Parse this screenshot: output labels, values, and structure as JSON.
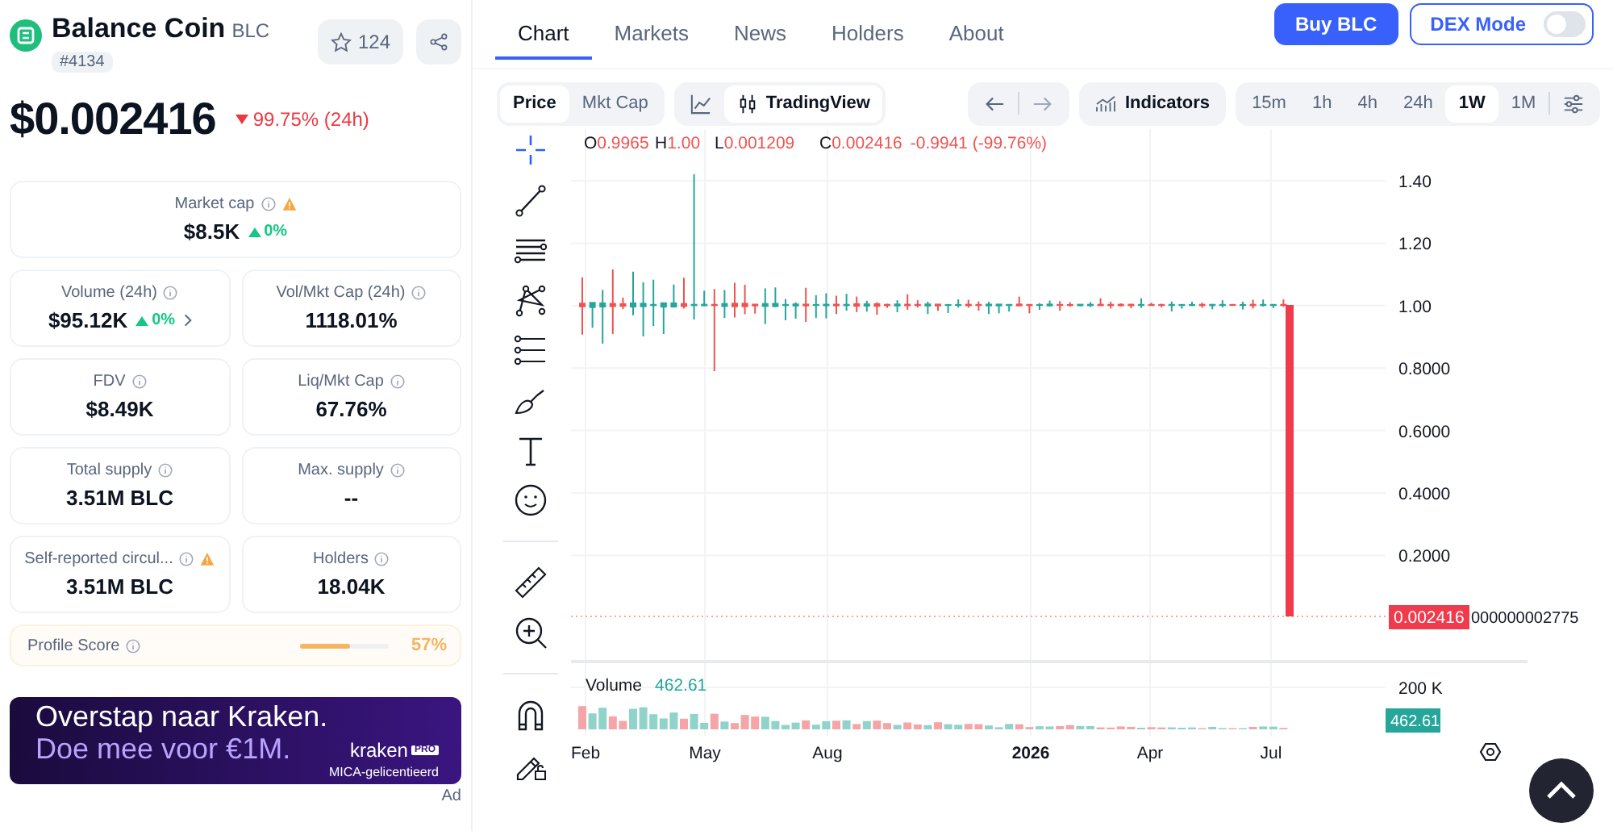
{
  "coin": {
    "name": "Balance Coin",
    "symbol": "BLC",
    "rank": "#4134",
    "watchlist_count": "124"
  },
  "price": {
    "value": "$0.002416",
    "change": "99.75% (24h)"
  },
  "market_cap": {
    "label": "Market cap",
    "value": "$8.5K",
    "change": "0%",
    "warning": true
  },
  "stats": [
    {
      "label": "Volume (24h)",
      "value": "$95.12K",
      "change": "0%",
      "warning": false,
      "expandable": true
    },
    {
      "label": "Vol/Mkt Cap (24h)",
      "value": "1118.01%",
      "warning": false,
      "expandable": false
    },
    {
      "label": "FDV",
      "value": "$8.49K",
      "warning": false,
      "expandable": false
    },
    {
      "label": "Liq/Mkt Cap",
      "value": "67.76%",
      "warning": false,
      "expandable": false
    },
    {
      "label": "Total supply",
      "value": "3.51M BLC",
      "warning": false,
      "expandable": false
    },
    {
      "label": "Max. supply",
      "value": "--",
      "warning": false,
      "expandable": false
    },
    {
      "label": "Self-reported circul...",
      "value": "3.51M BLC",
      "warning": true,
      "expandable": false
    },
    {
      "label": "Holders",
      "value": "18.04K",
      "warning": false,
      "expandable": false
    }
  ],
  "profile_score": {
    "label": "Profile Score",
    "value": "57%",
    "level": 0.57
  },
  "ad": {
    "headline": "Overstap naar Kraken.",
    "subline": "Doe mee voor €1M.",
    "brand": "kraken",
    "brand_badge": "PRO",
    "license": "MICA-gelicentieerd",
    "label": "Ad"
  },
  "tabs": [
    {
      "label": "Chart",
      "selected": true
    },
    {
      "label": "Markets",
      "selected": false
    },
    {
      "label": "News",
      "selected": false
    },
    {
      "label": "Holders",
      "selected": false
    },
    {
      "label": "About",
      "selected": false
    }
  ],
  "buy_button": "Buy BLC",
  "dex_mode": {
    "label": "DEX Mode",
    "on": false
  },
  "toolbar": {
    "metrics": [
      {
        "label": "Price",
        "selected": true
      },
      {
        "label": "Mkt Cap",
        "selected": false
      }
    ],
    "chart_types": [
      {
        "kind": "line",
        "selected": false
      },
      {
        "kind": "candles",
        "label": "TradingView",
        "selected": true
      }
    ],
    "indicators": "Indicators",
    "intervals": [
      {
        "label": "15m",
        "selected": false
      },
      {
        "label": "1h",
        "selected": false
      },
      {
        "label": "4h",
        "selected": false
      },
      {
        "label": "24h",
        "selected": false
      },
      {
        "label": "1W",
        "selected": true
      },
      {
        "label": "1M",
        "selected": false
      }
    ]
  },
  "chart": {
    "ohlc": [
      {
        "label": "O",
        "value": "0.9965"
      },
      {
        "label": "H",
        "value": "1.00"
      },
      {
        "label": "L",
        "value": "0.001209"
      },
      {
        "label": "C",
        "value": "0.002416"
      }
    ],
    "change": "-0.9941 (-99.76%)",
    "price_ticks": [
      "1.40",
      "1.20",
      "1.00",
      "0.8000",
      "0.6000",
      "0.4000",
      "0.2000"
    ],
    "last_price": "0.002416",
    "last_price_suffix": "000000002775",
    "volume_label": "Volume",
    "volume_value": "462.61",
    "volume_tick": "200 K",
    "volume_last": "462.61",
    "time_ticks": [
      "Feb",
      "May",
      "Aug",
      "2026",
      "Apr",
      "Jul"
    ]
  }
}
